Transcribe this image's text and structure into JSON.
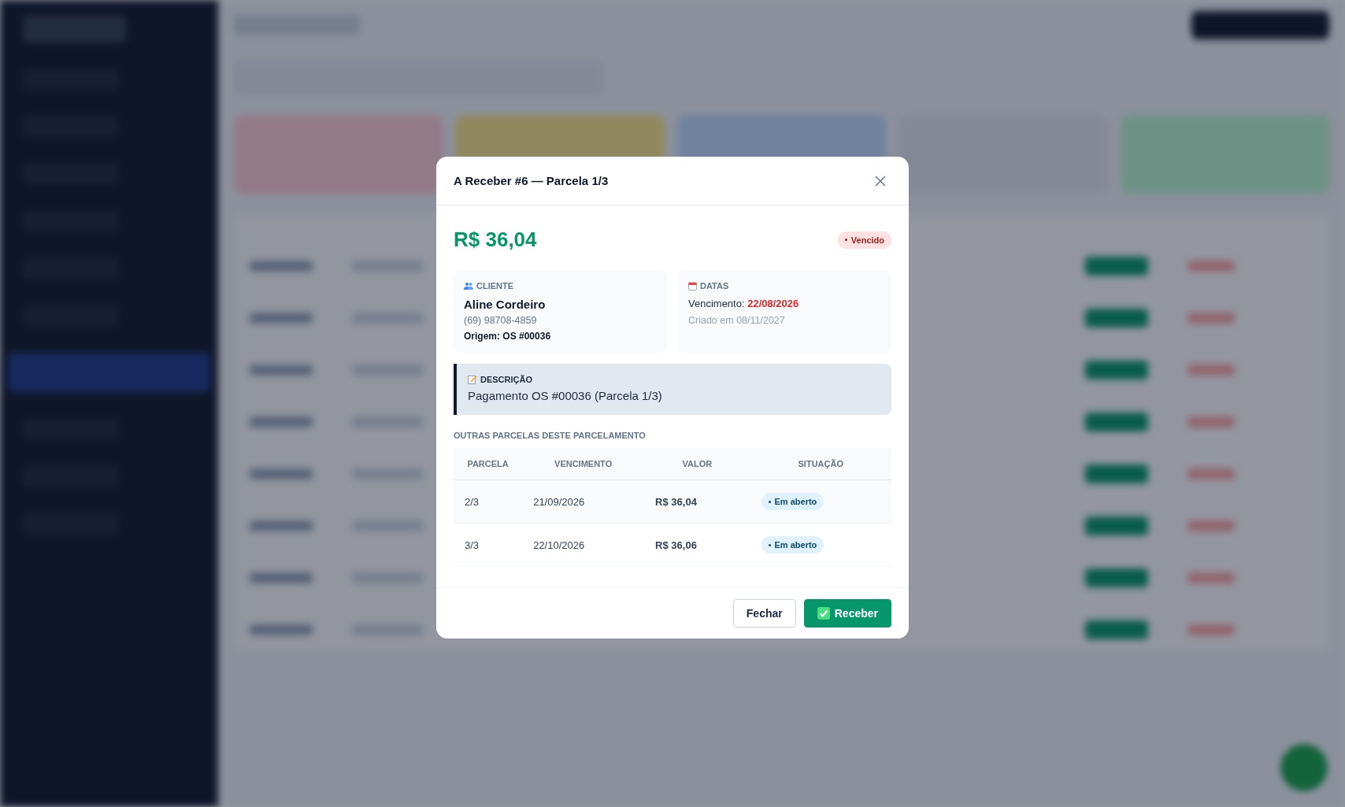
{
  "modal": {
    "title": "A Receber #6 — Parcela 1/3",
    "amount": "R$ 36,04",
    "status": {
      "kind": "overdue",
      "label": "Vencido"
    },
    "client": {
      "heading": "CLIENTE",
      "name": "Aline Cordeiro",
      "phone": "(69) 98708-4859",
      "origin": "Origem: OS #00036"
    },
    "dates": {
      "heading": "DATAS",
      "due_label": "Vencimento:",
      "due_date": "22/08/2026",
      "created": "Criado em 08/11/2027"
    },
    "description": {
      "heading": "DESCRIÇÃO",
      "text": "Pagamento OS #00036 (Parcela 1/3)"
    },
    "installments": {
      "title": "OUTRAS PARCELAS DESTE PARCELAMENTO",
      "columns": [
        "PARCELA",
        "VENCIMENTO",
        "VALOR",
        "SITUAÇÃO"
      ],
      "rows": [
        {
          "parcela": "2/3",
          "vencimento": "21/09/2026",
          "valor": "R$ 36,04",
          "status": {
            "kind": "open",
            "label": "Em aberto"
          }
        },
        {
          "parcela": "3/3",
          "vencimento": "22/10/2026",
          "valor": "R$ 36,06",
          "status": {
            "kind": "open",
            "label": "Em aberto"
          }
        }
      ]
    },
    "buttons": [
      {
        "kind": "secondary",
        "label": "Fechar"
      },
      {
        "kind": "primary",
        "label": "Receber"
      }
    ]
  }
}
